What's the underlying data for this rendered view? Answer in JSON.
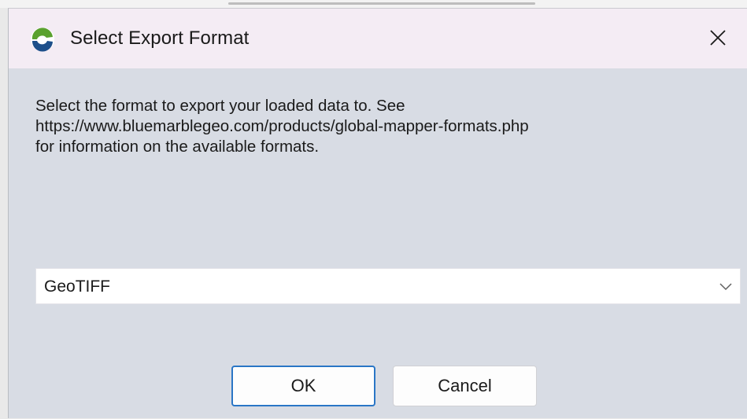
{
  "dialog": {
    "title": "Select Export Format",
    "close_label": "Close",
    "description_lines": [
      "Select the format to export your loaded data to. See",
      "https://www.bluemarblegeo.com/products/global-mapper-formats.php",
      "for information on the available formats."
    ],
    "format_select": {
      "selected": "GeoTIFF"
    },
    "buttons": {
      "ok": "OK",
      "cancel": "Cancel"
    }
  },
  "colors": {
    "titlebar_bg": "#f4ecf4",
    "dialog_bg": "#d8dce4",
    "default_button_border": "#2a76c6",
    "logo_green": "#5aa12e",
    "logo_blue": "#1d4f8a"
  },
  "icons": {
    "app": "global-mapper-logo-icon",
    "close": "close-icon",
    "dropdown": "chevron-down-icon"
  }
}
